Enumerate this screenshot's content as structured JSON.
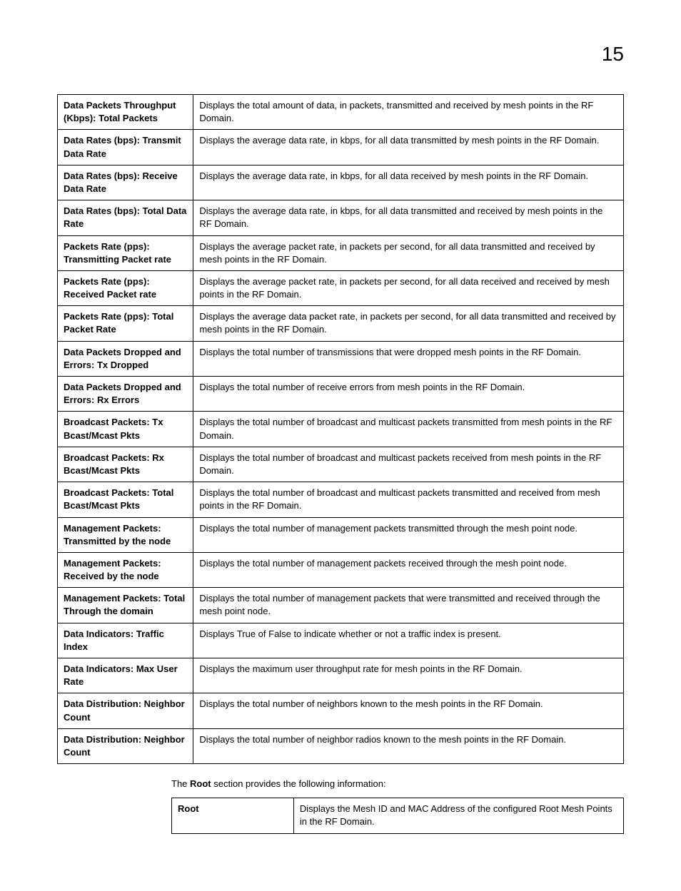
{
  "page_number": "15",
  "main_table": {
    "rows": [
      {
        "label": "Data Packets Throughput (Kbps): Total Packets",
        "desc": "Displays the total amount of data, in packets, transmitted and received by mesh points in the RF Domain."
      },
      {
        "label": "Data Rates (bps): Transmit Data Rate",
        "desc": "Displays the average data rate, in kbps, for all data transmitted by mesh points in the RF Domain."
      },
      {
        "label": "Data Rates (bps): Receive Data Rate",
        "desc": "Displays the average data rate, in kbps, for all data received by mesh points in the RF Domain."
      },
      {
        "label": "Data Rates (bps): Total Data Rate",
        "desc": "Displays the average data rate, in kbps, for all data transmitted and received by mesh points in the RF Domain."
      },
      {
        "label": "Packets Rate (pps): Transmitting Packet rate",
        "desc": "Displays the average packet rate, in packets per second, for all data transmitted and received by mesh points in the RF Domain."
      },
      {
        "label": "Packets Rate (pps): Received Packet rate",
        "desc": "Displays the average packet rate, in packets per second, for all data received and received by mesh points in the RF Domain."
      },
      {
        "label": "Packets Rate (pps): Total Packet Rate",
        "desc": "Displays the average data packet rate, in packets per second, for all data transmitted and received by mesh points in the RF Domain."
      },
      {
        "label": "Data Packets Dropped and Errors: Tx Dropped",
        "desc": "Displays the total number of transmissions that were dropped mesh points in the RF Domain."
      },
      {
        "label": "Data Packets Dropped and Errors: Rx Errors",
        "desc": "Displays the total number of receive errors from mesh points in the RF Domain."
      },
      {
        "label": "Broadcast Packets: Tx Bcast/Mcast Pkts",
        "desc": "Displays the total number of broadcast and multicast packets transmitted from mesh points in the RF Domain."
      },
      {
        "label": "Broadcast Packets: Rx Bcast/Mcast Pkts",
        "desc": "Displays the total number of broadcast and multicast packets received from mesh points in the RF Domain."
      },
      {
        "label": "Broadcast Packets: Total Bcast/Mcast Pkts",
        "desc": "Displays the total number of broadcast and multicast packets transmitted and received from mesh points in the RF Domain."
      },
      {
        "label": "Management Packets: Transmitted by the node",
        "desc": "Displays the total number of management packets transmitted through the mesh point node."
      },
      {
        "label": "Management Packets: Received by the node",
        "desc": "Displays the total number of management packets received through the mesh point node."
      },
      {
        "label": "Management Packets: Total Through the domain",
        "desc": "Displays the total number of management packets that were transmitted and received through the mesh point node."
      },
      {
        "label": "Data Indicators: Traffic Index",
        "desc": "Displays True of False to indicate whether or not a traffic index is present."
      },
      {
        "label": "Data Indicators: Max User Rate",
        "desc": "Displays the maximum user throughput rate for mesh points in the RF Domain."
      },
      {
        "label": "Data Distribution: Neighbor Count",
        "desc": "Displays the total number of neighbors known to the mesh points in the RF Domain."
      },
      {
        "label": "Data Distribution: Neighbor Count",
        "desc": "Displays the total number of neighbor radios known to the mesh points in the RF Domain."
      }
    ]
  },
  "intro": {
    "prefix": "The ",
    "bold": "Root",
    "suffix": " section provides the following information:"
  },
  "root_table": {
    "rows": [
      {
        "label": "Root",
        "desc": "Displays the Mesh ID and MAC Address of the configured Root Mesh Points in the RF Domain."
      }
    ]
  }
}
